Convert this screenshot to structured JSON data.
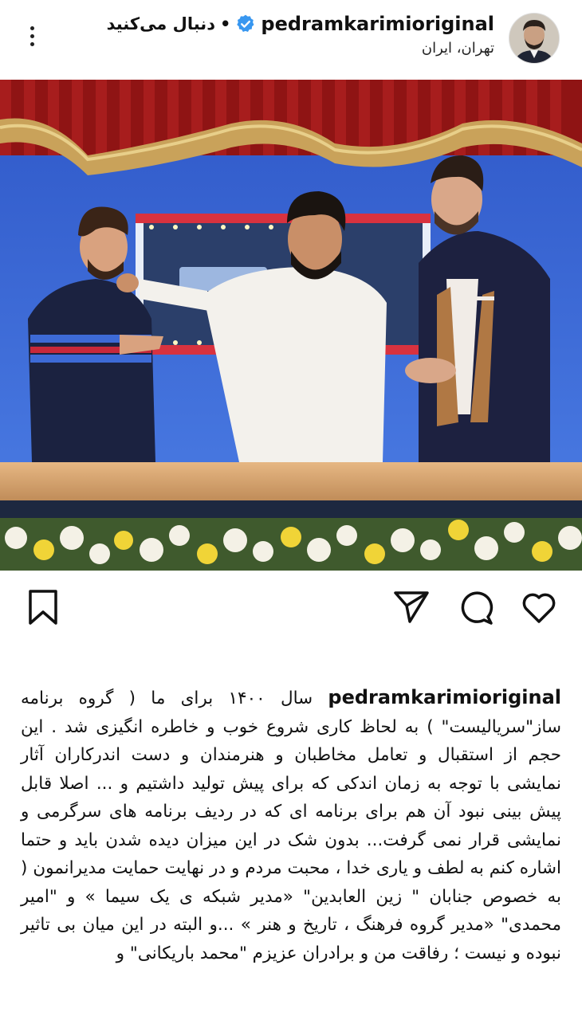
{
  "header": {
    "username": "pedramkarimioriginal",
    "follow_label": "دنبال می‌کنید",
    "separator": "•",
    "location": "تهران، ایران",
    "verified": true
  },
  "post": {
    "image_icon": "post-photo"
  },
  "actions": {
    "like": "heart-icon",
    "comment": "comment-icon",
    "share": "send-icon",
    "save": "bookmark-icon"
  },
  "caption": {
    "username": "pedramkarimioriginal",
    "text": "سال ۱۴۰۰ برای ما ( گروه برنامه ساز\"سریالیست\" ) به لحاظ کاری شروع خوب و خاطره انگیزی شد . این حجم از استقبال و تعامل مخاطبان و هنرمندان و دست اندرکاران آثار نمایشی با توجه به زمان اندکی که برای پیش تولید داشتیم و ... اصلا قابل پیش بینی نبود آن هم برای برنامه ای که در ردیف برنامه های سرگرمی و نمایشی قرار نمی گرفت... بدون شک در این میزان دیده شدن باید و حتما اشاره کنم به لطف و یاری خدا ، محبت مردم و در نهایت حمایت مدیرانمون ( به خصوص جنابان \" زین العابدین\" «مدیر شبکه ی یک سیما » و \"امیر محمدی\" «مدیر گروه فرهنگ ، تاریخ و هنر » ...و البته در این میان بی تاثیر نبوده و نیست ؛ رفاقت من و برادران عزیزم \"محمد باریکانی\" و"
  }
}
